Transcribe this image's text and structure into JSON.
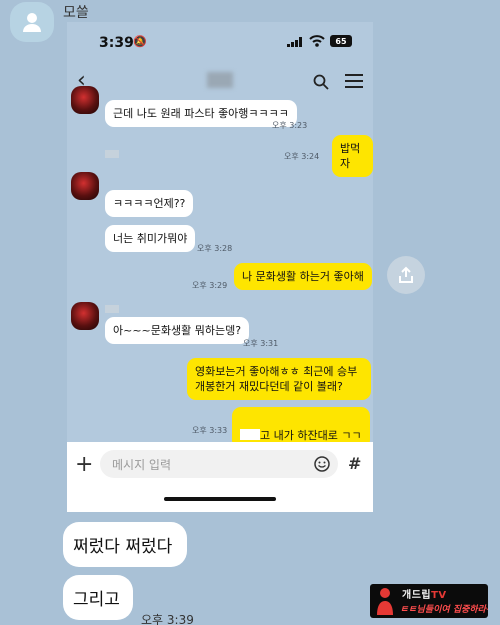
{
  "outer": {
    "sender_name": "모쓸",
    "messages": [
      "쩌렀다 쩌렀다",
      "그리고"
    ],
    "time": "오후 3:39"
  },
  "phone": {
    "status": {
      "time": "3:39",
      "battery": "65"
    },
    "input_placeholder": "메시지 입력",
    "messages": [
      {
        "dir": "in",
        "text": "근데 나도 원래 파스타 좋아행ㅋㅋㅋㅋ",
        "time": "오후 3:23"
      },
      {
        "dir": "out",
        "text": "밥먹자",
        "time": "오후 3:24"
      },
      {
        "dir": "in",
        "text": "ㅋㅋㅋㅋ언제??",
        "time": ""
      },
      {
        "dir": "in",
        "text": "너는 취미가뭐야",
        "time": "오후 3:28"
      },
      {
        "dir": "out",
        "text": "나 문화생활 하는거 좋아해",
        "time": "오후 3:29"
      },
      {
        "dir": "in",
        "text": "아~~~문화생활 뭐하는뎅?",
        "time": "오후 3:31"
      },
      {
        "dir": "out",
        "text": "영화보는거 좋아해ㅎㅎ 최근에 승부 개봉한거 재밌다던데 같이 볼래?",
        "time": ""
      },
      {
        "dir": "out",
        "text": "고 내가 하잔대로 ㄱㄱ",
        "time": "오후 3:33"
      }
    ]
  },
  "watermark": {
    "line1_a": "개드립",
    "line1_b": "TV",
    "line2": "ㅌㅌ님들이여 집중하라~"
  },
  "colors": {
    "background": "#a9c1d6",
    "out_bubble": "#fee500",
    "in_bubble": "#ffffff"
  }
}
